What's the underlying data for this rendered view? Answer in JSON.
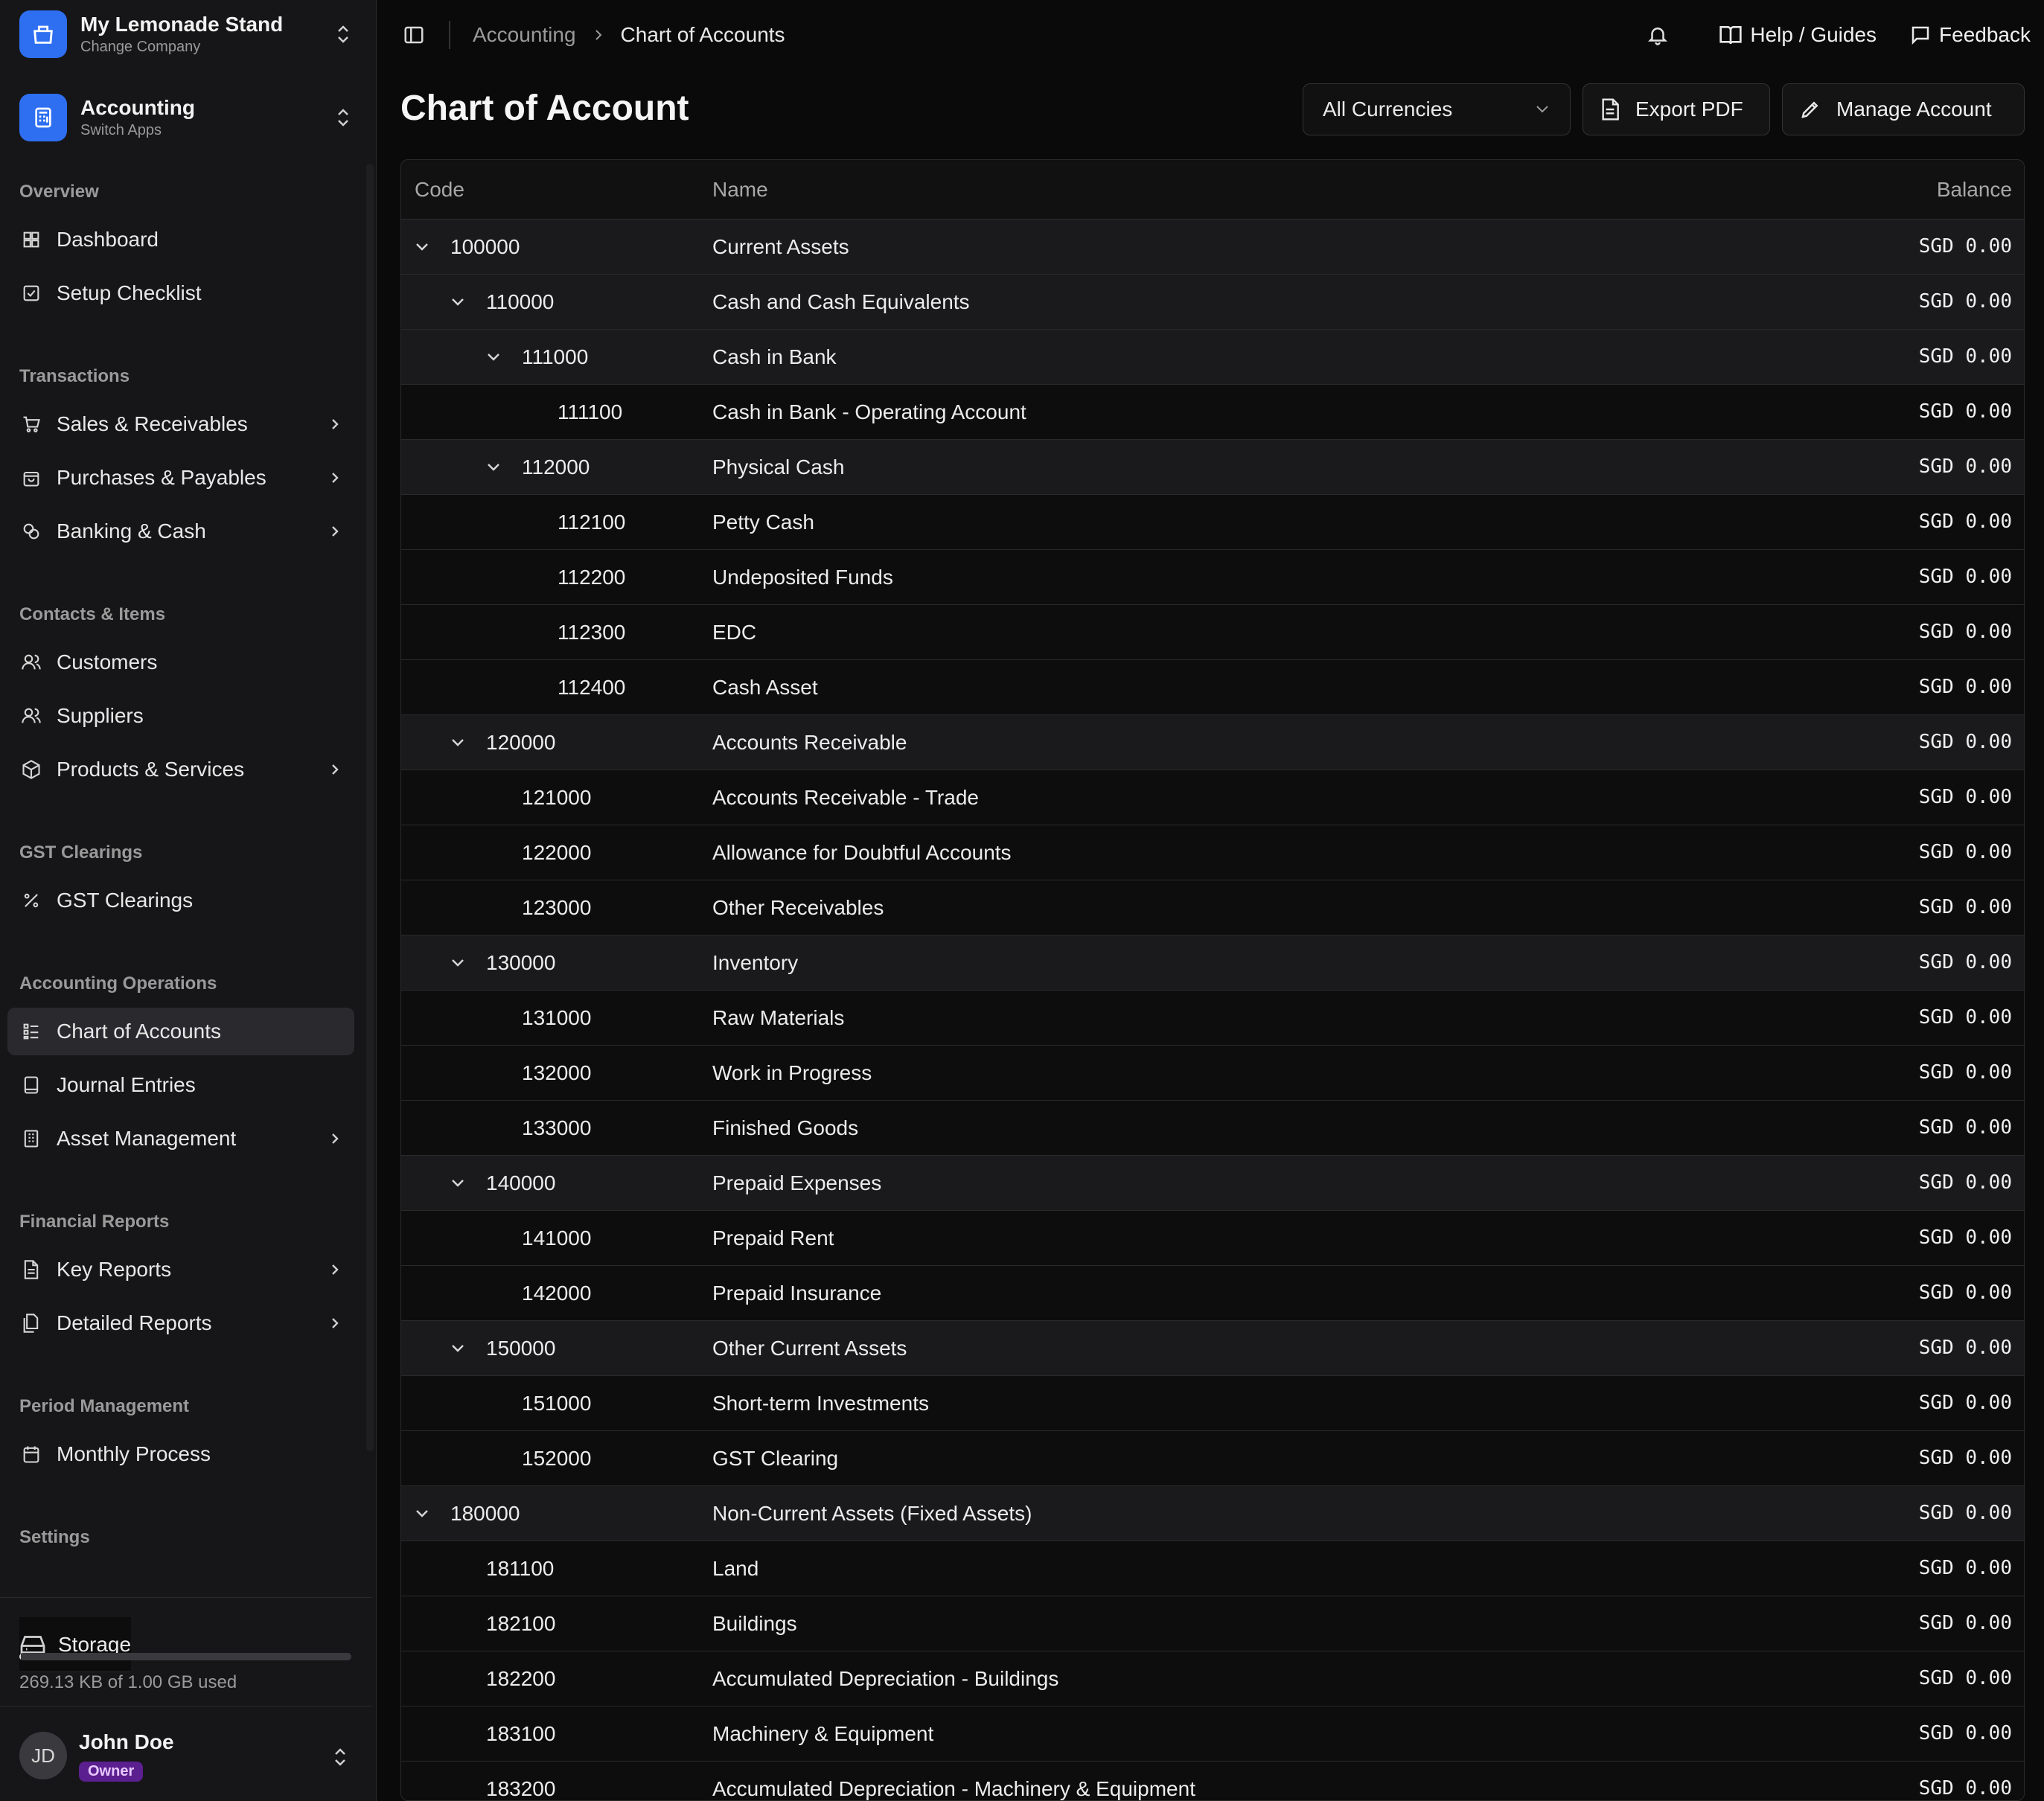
{
  "company": {
    "name": "My Lemonade Stand",
    "sub": "Change Company"
  },
  "app": {
    "name": "Accounting",
    "sub": "Switch Apps"
  },
  "sidebar": {
    "groups": [
      {
        "label": "Overview",
        "items": [
          {
            "label": "Dashboard",
            "icon": "dashboard-icon",
            "has_chevron": false
          },
          {
            "label": "Setup Checklist",
            "icon": "checklist-icon",
            "has_chevron": false
          }
        ]
      },
      {
        "label": "Transactions",
        "items": [
          {
            "label": "Sales & Receivables",
            "icon": "cart-icon",
            "has_chevron": true
          },
          {
            "label": "Purchases & Payables",
            "icon": "bag-icon",
            "has_chevron": true
          },
          {
            "label": "Banking & Cash",
            "icon": "coins-icon",
            "has_chevron": true
          }
        ]
      },
      {
        "label": "Contacts & Items",
        "items": [
          {
            "label": "Customers",
            "icon": "users-icon",
            "has_chevron": false
          },
          {
            "label": "Suppliers",
            "icon": "users-icon",
            "has_chevron": false
          },
          {
            "label": "Products & Services",
            "icon": "box-icon",
            "has_chevron": true
          }
        ]
      },
      {
        "label": "GST Clearings",
        "items": [
          {
            "label": "GST Clearings",
            "icon": "percent-icon",
            "has_chevron": false
          }
        ]
      },
      {
        "label": "Accounting Operations",
        "items": [
          {
            "label": "Chart of Accounts",
            "icon": "list-tree-icon",
            "has_chevron": false,
            "active": true
          },
          {
            "label": "Journal Entries",
            "icon": "book-icon",
            "has_chevron": false
          },
          {
            "label": "Asset Management",
            "icon": "building-icon",
            "has_chevron": true
          }
        ]
      },
      {
        "label": "Financial Reports",
        "items": [
          {
            "label": "Key Reports",
            "icon": "file-icon",
            "has_chevron": true
          },
          {
            "label": "Detailed Reports",
            "icon": "files-icon",
            "has_chevron": true
          }
        ]
      },
      {
        "label": "Period Management",
        "items": [
          {
            "label": "Monthly Process",
            "icon": "calendar-icon",
            "has_chevron": false
          }
        ]
      },
      {
        "label": "Settings",
        "items": []
      }
    ]
  },
  "storage": {
    "label": "Storage",
    "used_text": "269.13 KB of 1.00 GB used",
    "used_fraction": 0.0003
  },
  "user": {
    "initials": "JD",
    "name": "John Doe",
    "role": "Owner"
  },
  "topbar": {
    "breadcrumb": [
      "Accounting",
      "Chart of Accounts"
    ],
    "help_label": "Help / Guides",
    "feedback_label": "Feedback"
  },
  "page": {
    "title": "Chart of Account",
    "currency_select": "All Currencies",
    "export_label": "Export PDF",
    "manage_label": "Manage Account"
  },
  "table": {
    "headers": {
      "code": "Code",
      "name": "Name",
      "balance": "Balance"
    },
    "rows": [
      {
        "level": 0,
        "code": "100000",
        "name": "Current Assets",
        "balance": "SGD 0.00",
        "expandable": true
      },
      {
        "level": 1,
        "code": "110000",
        "name": "Cash and Cash Equivalents",
        "balance": "SGD 0.00",
        "expandable": true
      },
      {
        "level": 2,
        "code": "111000",
        "name": "Cash in Bank",
        "balance": "SGD 0.00",
        "expandable": true
      },
      {
        "level": 3,
        "code": "111100",
        "name": "Cash in Bank - Operating Account",
        "balance": "SGD 0.00",
        "expandable": false
      },
      {
        "level": 2,
        "code": "112000",
        "name": "Physical Cash",
        "balance": "SGD 0.00",
        "expandable": true
      },
      {
        "level": 3,
        "code": "112100",
        "name": "Petty Cash",
        "balance": "SGD 0.00",
        "expandable": false
      },
      {
        "level": 3,
        "code": "112200",
        "name": "Undeposited Funds",
        "balance": "SGD 0.00",
        "expandable": false
      },
      {
        "level": 3,
        "code": "112300",
        "name": "EDC",
        "balance": "SGD 0.00",
        "expandable": false
      },
      {
        "level": 3,
        "code": "112400",
        "name": "Cash Asset",
        "balance": "SGD 0.00",
        "expandable": false
      },
      {
        "level": 1,
        "code": "120000",
        "name": "Accounts Receivable",
        "balance": "SGD 0.00",
        "expandable": true
      },
      {
        "level": 2,
        "code": "121000",
        "name": "Accounts Receivable - Trade",
        "balance": "SGD 0.00",
        "expandable": false
      },
      {
        "level": 2,
        "code": "122000",
        "name": "Allowance for Doubtful Accounts",
        "balance": "SGD 0.00",
        "expandable": false
      },
      {
        "level": 2,
        "code": "123000",
        "name": "Other Receivables",
        "balance": "SGD 0.00",
        "expandable": false
      },
      {
        "level": 1,
        "code": "130000",
        "name": "Inventory",
        "balance": "SGD 0.00",
        "expandable": true
      },
      {
        "level": 2,
        "code": "131000",
        "name": "Raw Materials",
        "balance": "SGD 0.00",
        "expandable": false
      },
      {
        "level": 2,
        "code": "132000",
        "name": "Work in Progress",
        "balance": "SGD 0.00",
        "expandable": false
      },
      {
        "level": 2,
        "code": "133000",
        "name": "Finished Goods",
        "balance": "SGD 0.00",
        "expandable": false
      },
      {
        "level": 1,
        "code": "140000",
        "name": "Prepaid Expenses",
        "balance": "SGD 0.00",
        "expandable": true
      },
      {
        "level": 2,
        "code": "141000",
        "name": "Prepaid Rent",
        "balance": "SGD 0.00",
        "expandable": false
      },
      {
        "level": 2,
        "code": "142000",
        "name": "Prepaid Insurance",
        "balance": "SGD 0.00",
        "expandable": false
      },
      {
        "level": 1,
        "code": "150000",
        "name": "Other Current Assets",
        "balance": "SGD 0.00",
        "expandable": true
      },
      {
        "level": 2,
        "code": "151000",
        "name": "Short-term Investments",
        "balance": "SGD 0.00",
        "expandable": false
      },
      {
        "level": 2,
        "code": "152000",
        "name": "GST Clearing",
        "balance": "SGD 0.00",
        "expandable": false
      },
      {
        "level": 0,
        "code": "180000",
        "name": "Non-Current Assets (Fixed Assets)",
        "balance": "SGD 0.00",
        "expandable": true
      },
      {
        "level": 1,
        "code": "181100",
        "name": "Land",
        "balance": "SGD 0.00",
        "expandable": false
      },
      {
        "level": 1,
        "code": "182100",
        "name": "Buildings",
        "balance": "SGD 0.00",
        "expandable": false
      },
      {
        "level": 1,
        "code": "182200",
        "name": "Accumulated Depreciation - Buildings",
        "balance": "SGD 0.00",
        "expandable": false
      },
      {
        "level": 1,
        "code": "183100",
        "name": "Machinery & Equipment",
        "balance": "SGD 0.00",
        "expandable": false
      },
      {
        "level": 1,
        "code": "183200",
        "name": "Accumulated Depreciation - Machinery & Equipment",
        "balance": "SGD 0.00",
        "expandable": false
      }
    ]
  },
  "colors": {
    "accent": "#2e6ff2",
    "owner_badge": "#5b1f8f",
    "background": "#0a0a0a",
    "sidebar": "#161618"
  }
}
